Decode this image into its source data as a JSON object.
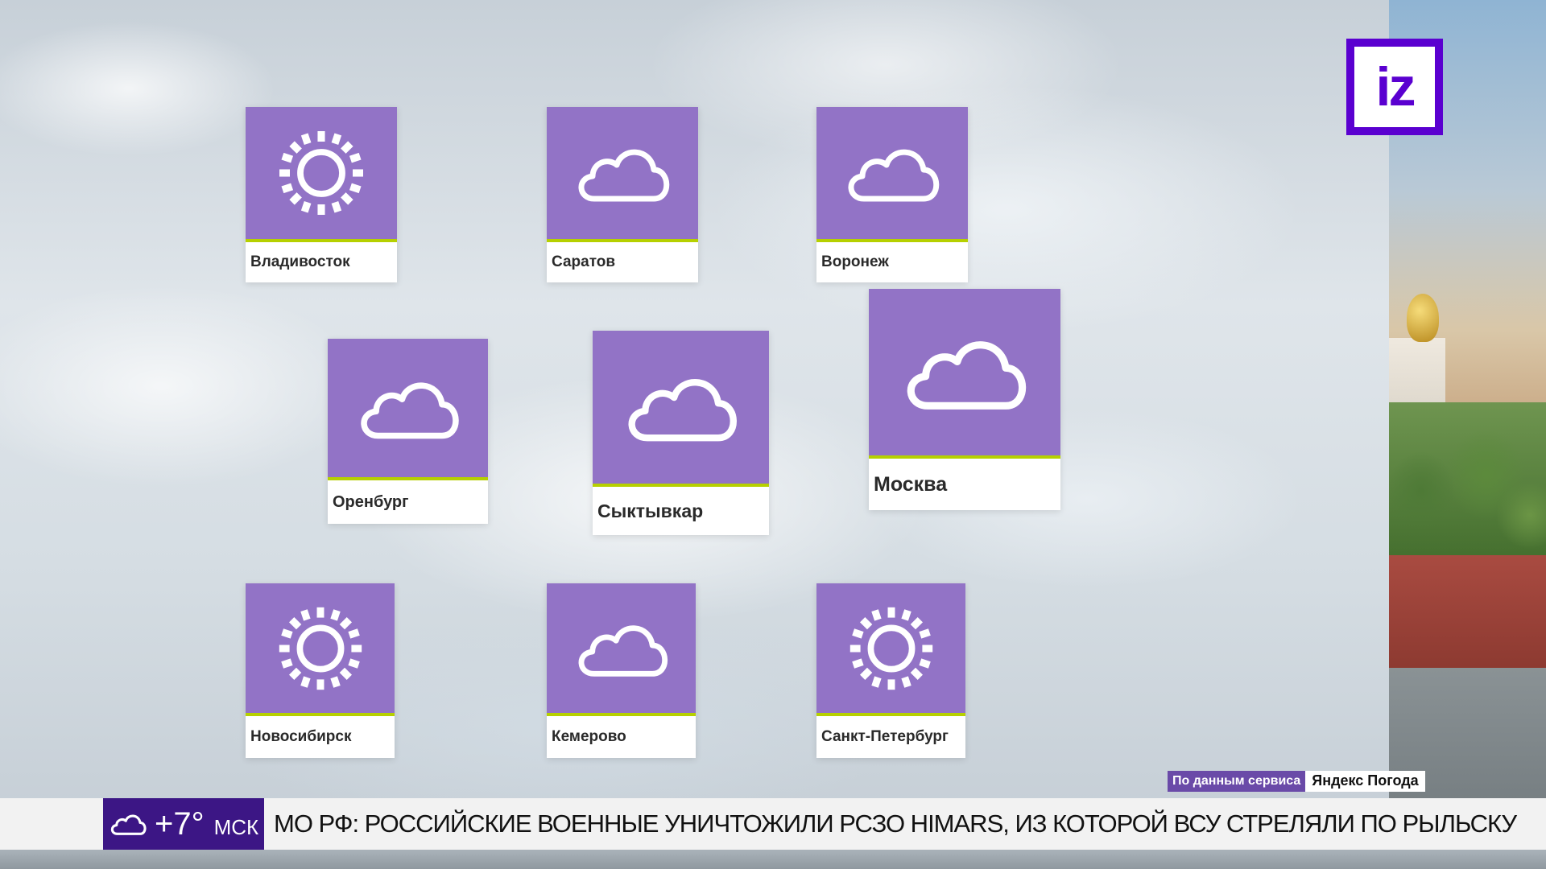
{
  "logo": {
    "text": "iz"
  },
  "cities": [
    {
      "name": "Владивосток",
      "icon": "sun-icon"
    },
    {
      "name": "Саратов",
      "icon": "cloud-icon"
    },
    {
      "name": "Воронеж",
      "icon": "cloud-icon"
    },
    {
      "name": "Оренбург",
      "icon": "cloud-icon"
    },
    {
      "name": "Сыктывкар",
      "icon": "cloud-icon"
    },
    {
      "name": "Москва",
      "icon": "cloud-icon"
    },
    {
      "name": "Новосибирск",
      "icon": "sun-icon"
    },
    {
      "name": "Кемерово",
      "icon": "cloud-icon"
    },
    {
      "name": "Санкт-Петербург",
      "icon": "sun-icon"
    }
  ],
  "source": {
    "prefix": "По данным сервиса",
    "brand": "Яндекс Погода"
  },
  "ticker": {
    "temperature": "+7°",
    "timezone": "МСК",
    "weather_icon": "cloud-icon",
    "headline": "МО РФ: РОССИЙСКИЕ ВОЕННЫЕ УНИЧТОЖИЛИ РСЗО HIMARS, ИЗ КОТОРОЙ ВСУ СТРЕЛЯЛИ ПО РЫЛЬСКУ"
  },
  "colors": {
    "card_purple": "#9273c6",
    "card_accent": "#b6d000",
    "brand_purple": "#5a00d0",
    "ticker_purple": "#3c1685"
  }
}
